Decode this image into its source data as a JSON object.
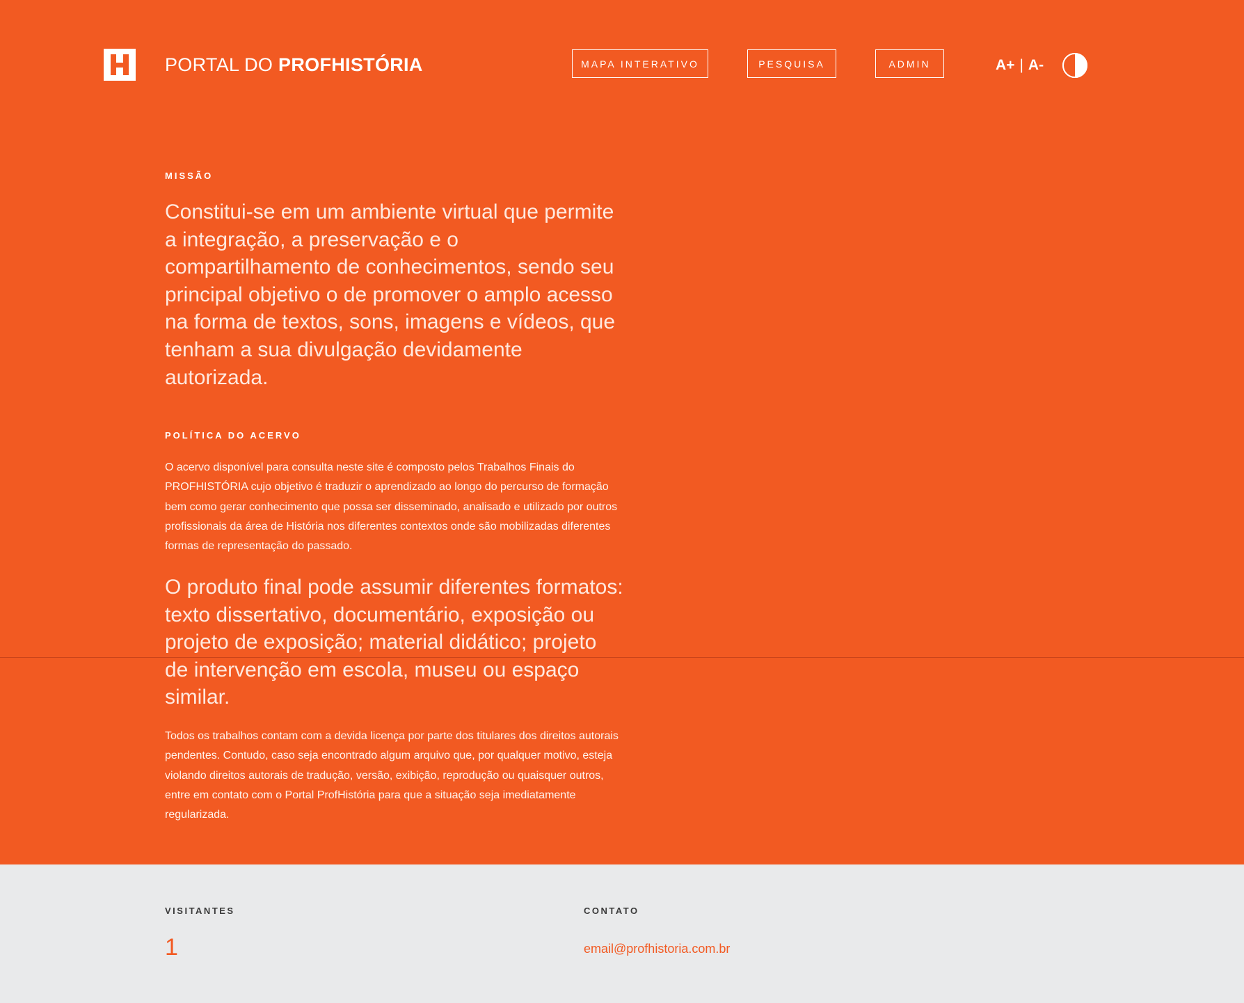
{
  "header": {
    "title_light": "PORTAL DO ",
    "title_bold": "PROFHISTÓRIA",
    "logo_letter": "H",
    "nav": {
      "mapa": "MAPA INTERATIVO",
      "pesquisa": "PESQUISA",
      "admin": "ADMIN"
    },
    "font_increase": "A+",
    "font_separator": "|",
    "font_decrease": "A-",
    "contrast_icon": "contrast-toggle-icon"
  },
  "missao": {
    "label": "MISSÃO",
    "text": "Constitui-se em um ambiente virtual que permite a integração, a preservação e o compartilhamento de conhecimentos, sendo seu principal objetivo o de promover o amplo acesso na forma de textos, sons, imagens e vídeos, que tenham a sua divulgação devidamente autorizada."
  },
  "politica": {
    "label": "POLÍTICA DO ACERVO",
    "paragraph1": "O acervo disponível para consulta neste site é composto pelos Trabalhos Finais do PROFHISTÓRIA cujo objetivo é traduzir o aprendizado ao longo do percurso de formação bem como gerar conhecimento que possa ser disseminado, analisado e utilizado por outros profissionais da área de História nos diferentes contextos onde são mobilizadas diferentes formas de representação do passado.",
    "lead2": "O produto final pode assumir diferentes formatos: texto dissertativo, documentário, exposição ou projeto de exposição; material didático; projeto de intervenção em escola, museu ou espaço similar.",
    "paragraph2": "Todos os trabalhos contam com a devida licença por parte dos titulares dos direitos autorais pendentes. Contudo, caso seja encontrado algum arquivo que, por qualquer motivo, esteja violando direitos autorais de tradução, versão, exibição, reprodução ou quaisquer outros, entre em contato com o Portal ProfHistória para que a situação seja imediatamente regularizada."
  },
  "footer": {
    "visitantes_label": "VISITANTES",
    "visitantes_count": "1",
    "contato_label": "CONTATO",
    "contato_email": "email@profhistoria.com.br"
  },
  "colors": {
    "brand": "#f25a22",
    "footer_bg": "#e9eaeb",
    "text_light": "#ffffff"
  }
}
